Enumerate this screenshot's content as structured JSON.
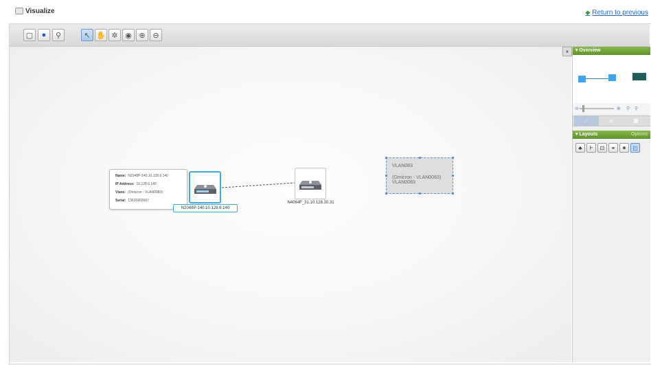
{
  "page": {
    "title": "Visualize",
    "return_link": "Return to previous"
  },
  "toolbar": {
    "buttons": [
      {
        "name": "layout-icon",
        "glyph": "⛶"
      },
      {
        "name": "info-icon",
        "glyph": "❶"
      },
      {
        "name": "find-icon",
        "glyph": "⚲"
      },
      {
        "name": "select-icon",
        "glyph": "↖",
        "active": true
      },
      {
        "name": "pan-icon",
        "glyph": "✋"
      },
      {
        "name": "connect-icon",
        "glyph": "✲"
      },
      {
        "name": "eye-icon",
        "glyph": "◉"
      },
      {
        "name": "zoom-in-icon",
        "glyph": "⊕"
      },
      {
        "name": "zoom-out-icon",
        "glyph": "⊖"
      }
    ]
  },
  "tooltip": {
    "rows": [
      {
        "label": "Name:",
        "value": "N2048P-140.10.128.6.140"
      },
      {
        "label": "IP Address:",
        "value": "10.128.6.140"
      },
      {
        "label": "Vlans:",
        "value": "(Omicron - VLAN0083)"
      },
      {
        "label": "Serial:",
        "value": "13620902667"
      }
    ]
  },
  "nodes": {
    "node1_label": "N2048P-140.10.128.6.140",
    "node2_label": "N4064F_31.10.128.30.31"
  },
  "vlan": {
    "line1": "VLAN083",
    "line2": "(Omicron - VLAN0083)",
    "line3": "VLAN0083"
  },
  "right_panel": {
    "collapse_label": "»",
    "overview_title": "Overview",
    "layouts_title": "Layouts",
    "layouts_more": "Options",
    "layout_icons": [
      "hierarchic-layout-icon",
      "tree-layout-icon",
      "orthogonal-layout-icon",
      "organic-layout-icon",
      "radial-layout-icon",
      "circular-layout-icon"
    ],
    "zoom_level": 0.1
  },
  "colors": {
    "accent_green": "#6da33a",
    "node_highlight": "#41a8dc",
    "link": "#2a6fbf"
  }
}
